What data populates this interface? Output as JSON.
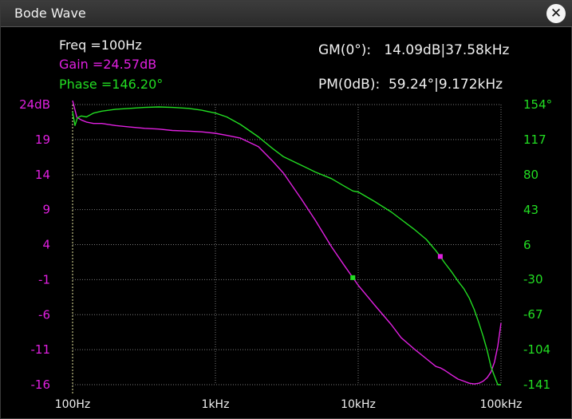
{
  "window": {
    "title": "Bode Wave",
    "close_icon": "close-icon"
  },
  "readout": {
    "freq": "Freq =100Hz",
    "gain": "Gain =24.57dB",
    "phase": "Phase =146.20°",
    "gm": "GM(0°):   14.09dB|37.58kHz",
    "pm": "PM(0dB):  59.24°|9.172kHz"
  },
  "colors": {
    "gain": "#e020e0",
    "phase": "#22dd22",
    "background": "#000000",
    "grid": "#7a7a7a",
    "cursor": "#e6e6a0",
    "text": "#f0f0f0"
  },
  "chart_data": {
    "type": "line",
    "x_scale": "log",
    "xlim": [
      100,
      100000
    ],
    "x_ticks": [
      {
        "value": 100,
        "label": "100Hz"
      },
      {
        "value": 1000,
        "label": "1kHz"
      },
      {
        "value": 10000,
        "label": "10kHz"
      },
      {
        "value": 100000,
        "label": "100kHz"
      }
    ],
    "y_left": {
      "ylim": [
        -16,
        24
      ],
      "tick_labels": [
        "24dB",
        "19",
        "14",
        "9",
        "4",
        "-1",
        "-6",
        "-11",
        "-16"
      ],
      "tick_values": [
        24,
        19,
        14,
        9,
        4,
        -1,
        -6,
        -11,
        -16
      ]
    },
    "y_right": {
      "ylim": [
        -141,
        154
      ],
      "tick_labels": [
        "154°",
        "117",
        "80",
        "43",
        "6",
        "-30",
        "-67",
        "-104",
        "-141"
      ],
      "tick_values": [
        154,
        117,
        80,
        43,
        6,
        -30,
        -67,
        -104,
        -141
      ]
    },
    "grid": true,
    "cursor_x": 100,
    "series": [
      {
        "axis": "left",
        "x": [
          100,
          107,
          115,
          125,
          140,
          160,
          200,
          250,
          320,
          400,
          500,
          650,
          800,
          1000,
          1200,
          1500,
          2000,
          2500,
          3000,
          4000,
          5000,
          6500,
          8000,
          10000,
          13000,
          17000,
          20000,
          25000,
          30000,
          35000,
          37580,
          40000,
          45000,
          50000,
          55000,
          60000,
          65000,
          70000,
          75000,
          80000,
          85000,
          90000,
          95000,
          100000
        ],
        "values": [
          24.57,
          22.2,
          21.8,
          21.5,
          21.3,
          21.3,
          21.0,
          20.8,
          20.6,
          20.5,
          20.3,
          20.2,
          20.1,
          19.9,
          19.6,
          19.2,
          18.0,
          16.0,
          14.2,
          10.5,
          7.5,
          3.7,
          1.0,
          -1.8,
          -4.6,
          -7.4,
          -9.3,
          -11.0,
          -12.3,
          -13.4,
          -13.6,
          -13.9,
          -14.6,
          -15.2,
          -15.5,
          -15.8,
          -15.9,
          -15.8,
          -15.5,
          -15.0,
          -14.2,
          -12.8,
          -10.5,
          -7.2
        ]
      },
      {
        "axis": "right",
        "x": [
          100,
          104,
          108,
          115,
          125,
          140,
          160,
          200,
          250,
          320,
          400,
          500,
          650,
          800,
          1000,
          1200,
          1500,
          2000,
          2500,
          3000,
          4000,
          5000,
          6500,
          8000,
          9172,
          10000,
          13000,
          17000,
          20000,
          25000,
          30000,
          35000,
          37580,
          40000,
          45000,
          50000,
          55000,
          60000,
          65000,
          70000,
          75000,
          80000,
          85000,
          90000,
          95000,
          100000
        ],
        "values": [
          146.2,
          132.0,
          140.0,
          142.0,
          141.0,
          145.0,
          147.0,
          149.0,
          150.0,
          151.0,
          151.5,
          151.0,
          150.0,
          148.0,
          145.0,
          141.0,
          133.0,
          120.0,
          108.0,
          99.0,
          90.0,
          83.0,
          76.0,
          68.0,
          63.0,
          62.0,
          52.0,
          41.0,
          33.0,
          22.0,
          12.0,
          0.0,
          -6.0,
          -12.0,
          -22.0,
          -32.0,
          -40.0,
          -50.0,
          -62.0,
          -76.0,
          -90.0,
          -105.0,
          -122.0,
          -132.0,
          -141.0,
          -141.0
        ]
      }
    ],
    "markers": [
      {
        "series": 0,
        "x": 9172,
        "y": 0.0
      },
      {
        "series": 1,
        "x": 37580,
        "y": 0.0
      }
    ]
  }
}
